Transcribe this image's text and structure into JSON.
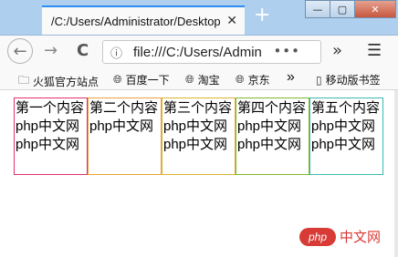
{
  "window": {
    "tab_title": "/C:/Users/Administrator/Desktop",
    "tab_close": "✕",
    "new_tab": "+",
    "minimize": "—",
    "maximize": "▢",
    "close": "✕"
  },
  "navbar": {
    "back": "←",
    "forward": "→",
    "reload": "C",
    "url": "file:///C:/Users/Admin",
    "url_more": "•••",
    "overflow": "»",
    "menu": "☰"
  },
  "bookmarks": {
    "items": [
      {
        "label": "火狐官方站点",
        "icon": "folder-icon"
      },
      {
        "label": "百度一下",
        "icon": "globe-icon"
      },
      {
        "label": "淘宝",
        "icon": "globe-icon"
      },
      {
        "label": "京东",
        "icon": "globe-icon"
      }
    ],
    "overflow": "»",
    "mobile": "移动版书签"
  },
  "boxes": [
    {
      "title": "第一个内容",
      "line1": "php中文网",
      "line2": "php中文网",
      "border": "#e0306a"
    },
    {
      "title": "第二个内容",
      "line1": "php中文网",
      "line2": "",
      "border": "#e8a33d"
    },
    {
      "title": "第三个内容",
      "line1": "php中文网",
      "line2": "php中文网",
      "border": "#d9b531"
    },
    {
      "title": "第四个内容",
      "line1": "php中文网",
      "line2": "php中文网",
      "border": "#7fb82f"
    },
    {
      "title": "第五个内容",
      "line1": "php中文网",
      "line2": "php中文网",
      "border": "#3cb8b0"
    }
  ],
  "watermark": {
    "logo": "php",
    "text": "中文网"
  }
}
